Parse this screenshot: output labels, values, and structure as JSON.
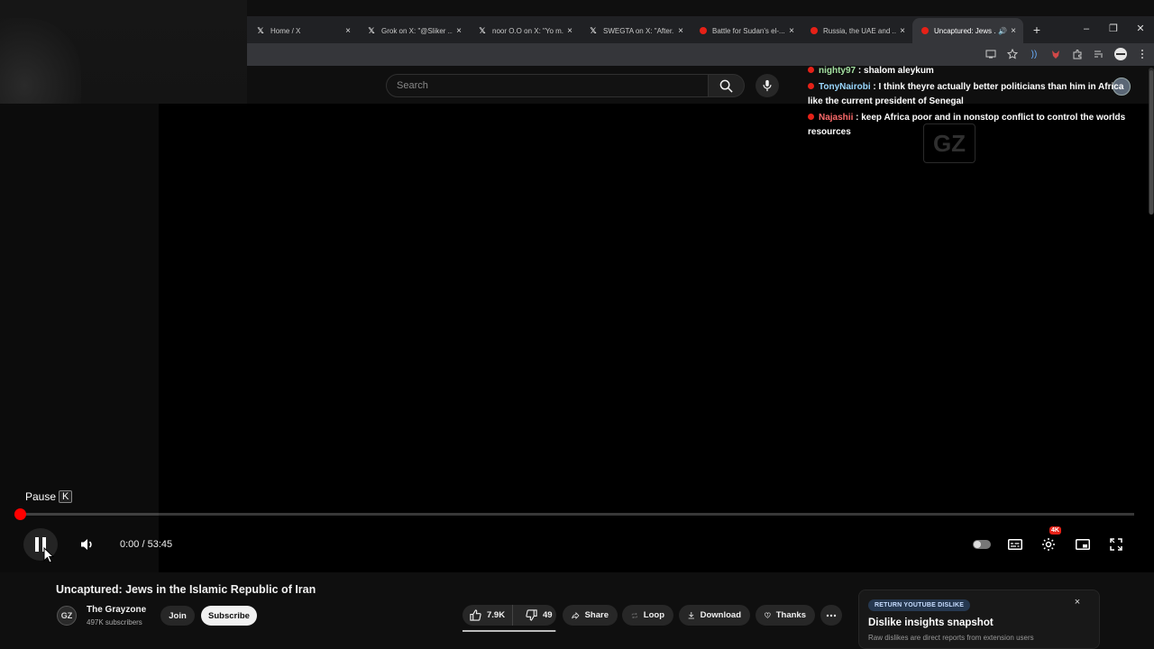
{
  "browser": {
    "tabs": [
      {
        "title": "Home / X",
        "icon": "x-icon",
        "active": false
      },
      {
        "title": "Grok on X: \"@Sliker ...",
        "icon": "x-icon",
        "active": false
      },
      {
        "title": "noor O.O on X: \"Yo m...",
        "icon": "x-icon",
        "active": false
      },
      {
        "title": "SWEGTA on X: \"After...",
        "icon": "x-icon",
        "active": false
      },
      {
        "title": "Battle for Sudan's el-...",
        "icon": "youtube-icon",
        "active": false
      },
      {
        "title": "Russia, the UAE and ...",
        "icon": "youtube-icon",
        "active": false
      },
      {
        "title": "Uncaptured: Jews ...",
        "icon": "youtube-icon",
        "active": true
      }
    ],
    "new_tab_label": "+",
    "minimize_label": "–",
    "restore_label": "❐",
    "close_label": "✕"
  },
  "youtube": {
    "search_placeholder": "Search"
  },
  "chat": {
    "messages": [
      {
        "user": "nighty97",
        "text": " : shalom aleykum"
      },
      {
        "user": "TonyNairobi",
        "text": " : I think theyre actually better politicians than him in Africa like the current president of Senegal"
      },
      {
        "user": "Najashii",
        "text": " : keep Africa poor and in nonstop conflict to control the worlds resources"
      }
    ],
    "watermark_text": "GZ"
  },
  "player": {
    "tooltip_label": "Pause",
    "tooltip_key": "K",
    "current_time": "0:00",
    "separator": " / ",
    "duration": "53:45",
    "progress_fraction": 0.0,
    "quality_badge": "4K",
    "accent_color": "#ff0000"
  },
  "video": {
    "title": "Uncaptured: Jews in the Islamic Republic of Iran",
    "channel_initials": "GZ",
    "channel_name": "The Grayzone",
    "subscribers": "497K subscribers",
    "join_label": "Join",
    "subscribe_label": "Subscribe",
    "like_count": "7.9K",
    "dislike_count": "49",
    "like_ratio": 0.99,
    "share_label": "Share",
    "loop_label": "Loop",
    "download_label": "Download",
    "thanks_label": "Thanks"
  },
  "return_dislike": {
    "tag": "RETURN YOUTUBE DISLIKE",
    "title": "Dislike insights snapshot",
    "subtitle": "Raw dislikes are direct reports from extension users",
    "close_label": "×"
  }
}
